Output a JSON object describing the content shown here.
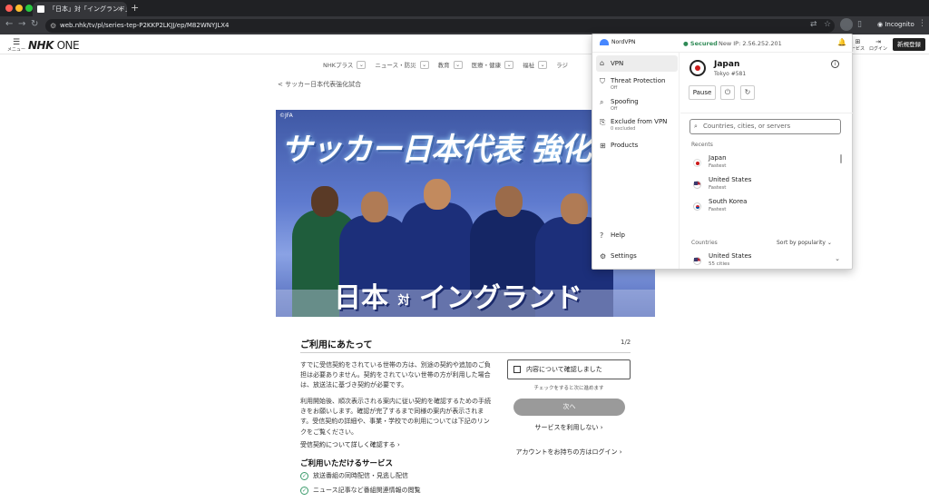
{
  "browser": {
    "tab_title": "「日本」対「イングランド」|",
    "tab_close": "×",
    "new_tab": "+",
    "url": "web.nhk/tv/pl/series-tep-P2KKP2LKJJ/ep/M82WNYJLX4",
    "incognito_label": "Incognito",
    "traffic_colors": [
      "#ff5f57",
      "#febc2e",
      "#28c840"
    ]
  },
  "nhk": {
    "menu_label": "メニュー",
    "logo_nhk": "NHK",
    "logo_one": "ONE",
    "service_label": "ービス",
    "login_label": "ログイン",
    "signup_label": "新規登録",
    "categories": [
      "NHKプラス",
      "ニュース・防災",
      "教育",
      "医療・健康",
      "福祉",
      "ラジ"
    ],
    "breadcrumb": "< サッカー日本代表強化試合",
    "hero": {
      "copyright": "©JFA",
      "title": "サッカー日本代表 強化試",
      "match_left": "日本",
      "match_vs": "対",
      "match_right": "イングランド"
    }
  },
  "modal": {
    "title": "ご利用にあたって",
    "page": "1/2",
    "para1": "すでに受信契約をされている世帯の方は、別途の契約や追加のご負担は必要ありません。契約をされていない世帯の方が利用した場合は、放送法に基づき契約が必要です。",
    "para2": "利用開始後、順次表示される案内に従い契約を確認するための手続きをお願いします。確認が完了するまで同様の案内が表示されます。受信契約の詳細や、事業・学校での利用については下記のリンクをご覧ください。",
    "contract_link": "受信契約について詳しく確認する ›",
    "services_title": "ご利用いただけるサービス",
    "services": [
      "放送番組の同時配信・見逃し配信",
      "ニュース記事など番組関連情報の閲覧"
    ],
    "confirm_label": "内容について確認しました",
    "confirm_hint": "チェックをすると次に進めます",
    "next_button": "次へ",
    "no_use_link": "サービスを利用しない ›",
    "login_link": "アカウントをお持ちの方はログイン ›"
  },
  "vpn": {
    "brand": "NordVPN",
    "status": "● Secured",
    "ip_label": "New IP: 2.56.252.201",
    "nav": [
      {
        "label": "VPN",
        "sub": ""
      },
      {
        "label": "Threat Protection",
        "sub": "Off"
      },
      {
        "label": "Spoofing",
        "sub": "Off"
      },
      {
        "label": "Exclude from VPN",
        "sub": "0 excluded"
      },
      {
        "label": "Products",
        "sub": ""
      },
      {
        "label": "Help",
        "sub": ""
      },
      {
        "label": "Settings",
        "sub": ""
      }
    ],
    "connected_country": "Japan",
    "connected_server": "Tokyo #581",
    "pause_label": "Pause",
    "search_placeholder": "Countries, cities, or servers",
    "recents_label": "Recents",
    "recents": [
      {
        "name": "Japan",
        "sub": "Fastest"
      },
      {
        "name": "United States",
        "sub": "Fastest"
      },
      {
        "name": "South Korea",
        "sub": "Fastest"
      }
    ],
    "countries_label": "Countries",
    "sort_label": "Sort by popularity ⌄",
    "countries": [
      {
        "name": "United States",
        "sub": "55 cities"
      }
    ],
    "accent": "#4687ff",
    "secured_color": "#2f8a56"
  }
}
